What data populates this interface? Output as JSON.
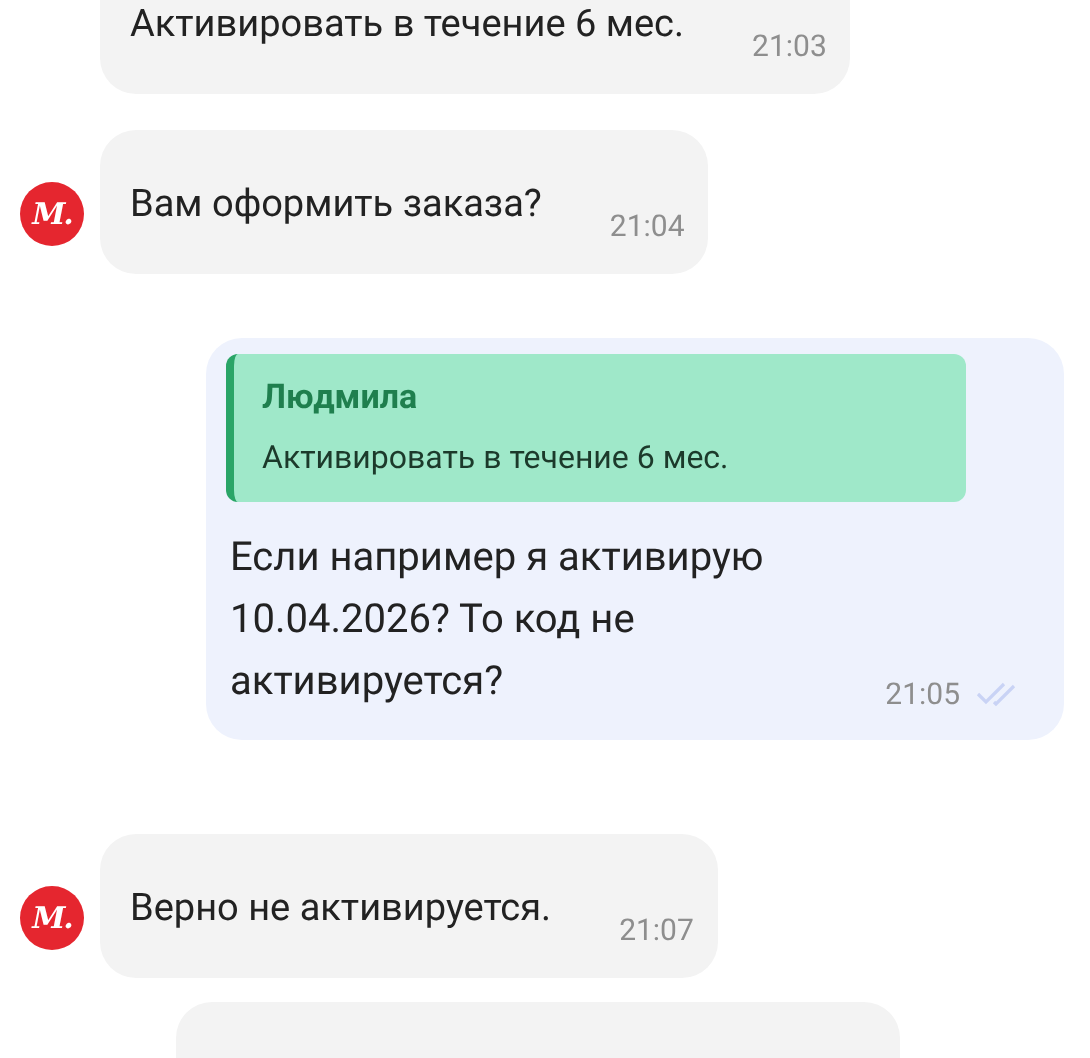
{
  "messages": [
    {
      "kind": "incoming",
      "avatar": false,
      "text": "Активировать в течение 6 мес.",
      "time": "21:03"
    },
    {
      "kind": "incoming",
      "avatar": true,
      "avatar_label": "М.",
      "text": "Вам оформить заказа?",
      "time": "21:04"
    },
    {
      "kind": "outgoing",
      "quote": {
        "author": "Людмила",
        "text": "Активировать в течение 6 мес."
      },
      "text": "Если например я активирую 10.04.2026? То код не активируется?",
      "time": "21:05",
      "read": true
    },
    {
      "kind": "incoming",
      "avatar": true,
      "avatar_label": "М.",
      "text": "Верно не активируется.",
      "time": "21:07"
    },
    {
      "kind": "cut"
    }
  ]
}
